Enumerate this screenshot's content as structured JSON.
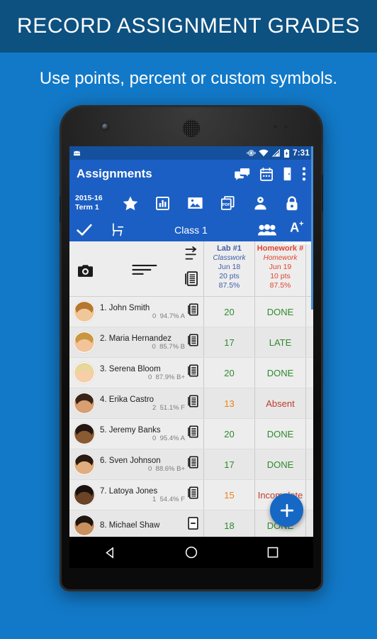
{
  "promo": {
    "headline": "RECORD ASSIGNMENT GRADES",
    "subhead": "Use points, percent or custom symbols.",
    "banner_color": "#0d5181",
    "background_color": "#1279c8"
  },
  "statusbar": {
    "app_icon": "android-head-icon",
    "icons": [
      "vibrate-icon",
      "wifi-icon",
      "signal-icon",
      "battery-charging-icon"
    ],
    "clock": "7:31",
    "color": "#14509e"
  },
  "appbar": {
    "color": "#1c5fc4",
    "title": "Assignments",
    "row1_icons": [
      "chat-bubbles-icon",
      "calendar-icon",
      "door-icon",
      "overflow-menu-icon"
    ],
    "term_line1": "2015-16",
    "term_line2": "Term 1",
    "row2_icons": [
      "star-icon",
      "bar-chart-icon",
      "photo-icon",
      "pdf-icon",
      "person-pin-icon",
      "lock-icon"
    ],
    "row3_left_icons": [
      "checkmark-icon",
      "desk-chair-icon"
    ],
    "class_name": "Class 1",
    "row3_right_icons": [
      "group-people-icon"
    ],
    "grade_tab_label": "A",
    "grade_tab_sup": "+"
  },
  "grid": {
    "header_icons": [
      "camera-icon",
      "sort-lines-icon",
      "sort-arrow-icon",
      "notes-icon"
    ],
    "columns": [
      {
        "title": "Lab #1",
        "category": "Classwork",
        "date": "Jun 18",
        "points": "20 pts",
        "percent": "87.5%",
        "color": "#3f5fa8"
      },
      {
        "title": "Homework #",
        "category": "Homework",
        "date": "Jun 19",
        "points": "10 pts",
        "percent": "87.5%",
        "color": "#e0452f"
      }
    ],
    "rows": [
      {
        "name": "1. John Smith",
        "missing": "0",
        "percent": "94.7%",
        "letter": "A",
        "avatar_skin": "#f0c79a",
        "avatar_hair": "#b5772f",
        "note_icon": "notes-icon",
        "cells": [
          {
            "value": "20",
            "tone": "green"
          },
          {
            "value": "DONE",
            "tone": "green"
          }
        ]
      },
      {
        "name": "2. Maria Hernandez",
        "missing": "0",
        "percent": "85.7%",
        "letter": "B",
        "avatar_skin": "#f3c49b",
        "avatar_hair": "#c8973f",
        "note_icon": "notes-icon",
        "cells": [
          {
            "value": "17",
            "tone": "green"
          },
          {
            "value": "LATE",
            "tone": "green"
          }
        ]
      },
      {
        "name": "3. Serena Bloom",
        "missing": "0",
        "percent": "87.9%",
        "letter": "B+",
        "avatar_skin": "#f6cfa8",
        "avatar_hair": "#e8d79a",
        "note_icon": "notes-icon",
        "cells": [
          {
            "value": "20",
            "tone": "green"
          },
          {
            "value": "DONE",
            "tone": "green"
          }
        ]
      },
      {
        "name": "4. Erika Castro",
        "missing": "2",
        "percent": "51.1%",
        "letter": "F",
        "avatar_skin": "#d79f72",
        "avatar_hair": "#3a2418",
        "note_icon": "notes-icon",
        "cells": [
          {
            "value": "13",
            "tone": "orange"
          },
          {
            "value": "Absent",
            "tone": "red"
          }
        ]
      },
      {
        "name": "5. Jeremy Banks",
        "missing": "0",
        "percent": "95.4%",
        "letter": "A",
        "avatar_skin": "#8a5a33",
        "avatar_hair": "#241610",
        "note_icon": "notes-icon",
        "cells": [
          {
            "value": "20",
            "tone": "green"
          },
          {
            "value": "DONE",
            "tone": "green"
          }
        ]
      },
      {
        "name": "6. Sven Johnson",
        "missing": "0",
        "percent": "88.6%",
        "letter": "B+",
        "avatar_skin": "#e0ad7e",
        "avatar_hair": "#2b1a12",
        "note_icon": "notes-icon",
        "cells": [
          {
            "value": "17",
            "tone": "green"
          },
          {
            "value": "DONE",
            "tone": "green"
          }
        ]
      },
      {
        "name": "7. Latoya Jones",
        "missing": "1",
        "percent": "54.4%",
        "letter": "F",
        "avatar_skin": "#6b4327",
        "avatar_hair": "#1a1110",
        "note_icon": "notes-icon",
        "cells": [
          {
            "value": "15",
            "tone": "orange"
          },
          {
            "value": "Incomplete",
            "tone": "red"
          }
        ]
      },
      {
        "name": "8. Michael Shaw",
        "missing": "",
        "percent": "",
        "letter": "",
        "avatar_skin": "#c9905f",
        "avatar_hair": "#20150f",
        "note_icon": "note-minus-icon",
        "cells": [
          {
            "value": "18",
            "tone": "green"
          },
          {
            "value": "DONE",
            "tone": "green"
          }
        ]
      }
    ]
  },
  "fab": {
    "icon": "plus-icon",
    "color": "#1668c4"
  },
  "navbar": {
    "icons": [
      "back-triangle-icon",
      "home-circle-icon",
      "recents-square-icon"
    ]
  }
}
